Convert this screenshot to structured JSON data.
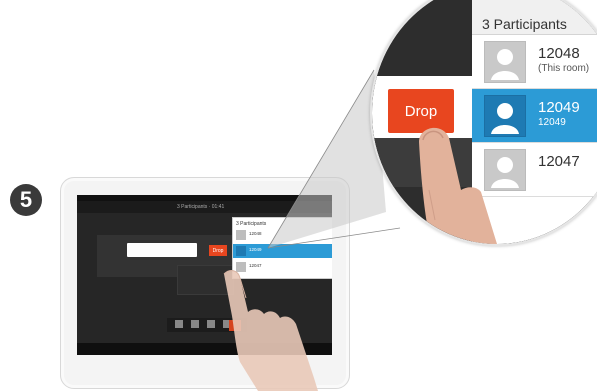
{
  "step": {
    "number": "5"
  },
  "tablet": {
    "topbar_title": "3 Participants · 01:41",
    "mini_panel_title": "3 Participants",
    "mini_drop_label": "Drop",
    "participants": [
      {
        "name": "12048",
        "sub": "(This room)"
      },
      {
        "name": "12049",
        "sub": "12049"
      },
      {
        "name": "12047",
        "sub": ""
      }
    ]
  },
  "zoom": {
    "panel_title": "3 Participants",
    "drop_label": "Drop",
    "participants": [
      {
        "name": "12048",
        "sub": "(This room)",
        "selected": false
      },
      {
        "name": "12049",
        "sub": "12049",
        "selected": true
      },
      {
        "name": "12047",
        "sub": "",
        "selected": false
      }
    ]
  },
  "colors": {
    "accent_blue": "#2c9bd6",
    "drop_red": "#e8461f",
    "screen_dark": "#262626"
  }
}
